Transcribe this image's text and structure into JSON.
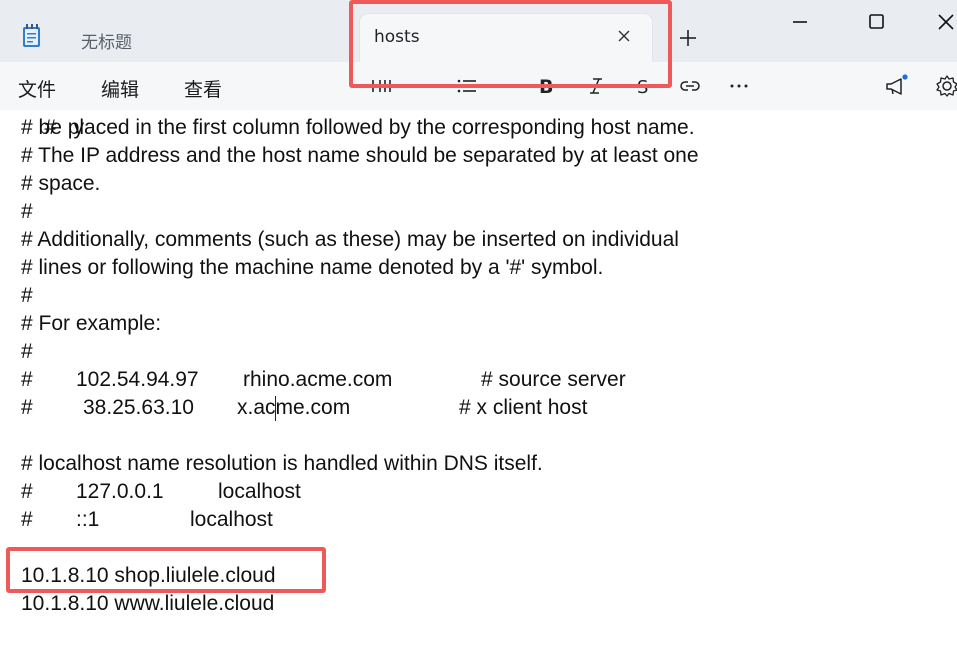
{
  "tabs": {
    "inactive_title": "无标题",
    "active_title": "hosts",
    "new_tab_symbol": "+"
  },
  "menu": {
    "file": "文件",
    "edit": "编辑",
    "view": "查看"
  },
  "toolbar_icons": [
    "heading-icon",
    "list-icon",
    "bold-icon",
    "italic-icon",
    "strikethrough-icon",
    "link-icon",
    "more-icon",
    "announcement-icon",
    "settings-icon"
  ],
  "editor": {
    "lines": [
      "# be placed in the first column followed by the corresponding host name.",
      "# The IP address and the host name should be separated by at least one",
      "# space.",
      "#",
      "# Additionally, comments (such as these) may be inserted on individual",
      "# lines or following the machine name denoted by a '#' symbol.",
      "#",
      "# For example:",
      "#"
    ],
    "example1": {
      "hash": "#",
      "ip": "102.54.94.97",
      "host": "rhino.acme.com",
      "comment": "# source server"
    },
    "example2": {
      "hash": "#",
      "ip": "38.25.63.10",
      "host": "x.acme.com",
      "comment": "# x client host"
    },
    "localhost_comment": "# localhost name resolution is handled within DNS itself.",
    "localhost1": {
      "hash": "#",
      "ip": "127.0.0.1",
      "host": "localhost"
    },
    "localhost2": {
      "hash": "#",
      "ip": "::1",
      "host": "localhost"
    },
    "entry1": "10.1.8.10 shop.liulele.cloud",
    "entry2": "10.1.8.10 www.liulele.cloud"
  },
  "colors": {
    "annotation": "#ee5a5a",
    "titlebar": "#e9edf2",
    "toolbar": "#f6f7f9",
    "accent_dot": "#1f6fd6"
  }
}
